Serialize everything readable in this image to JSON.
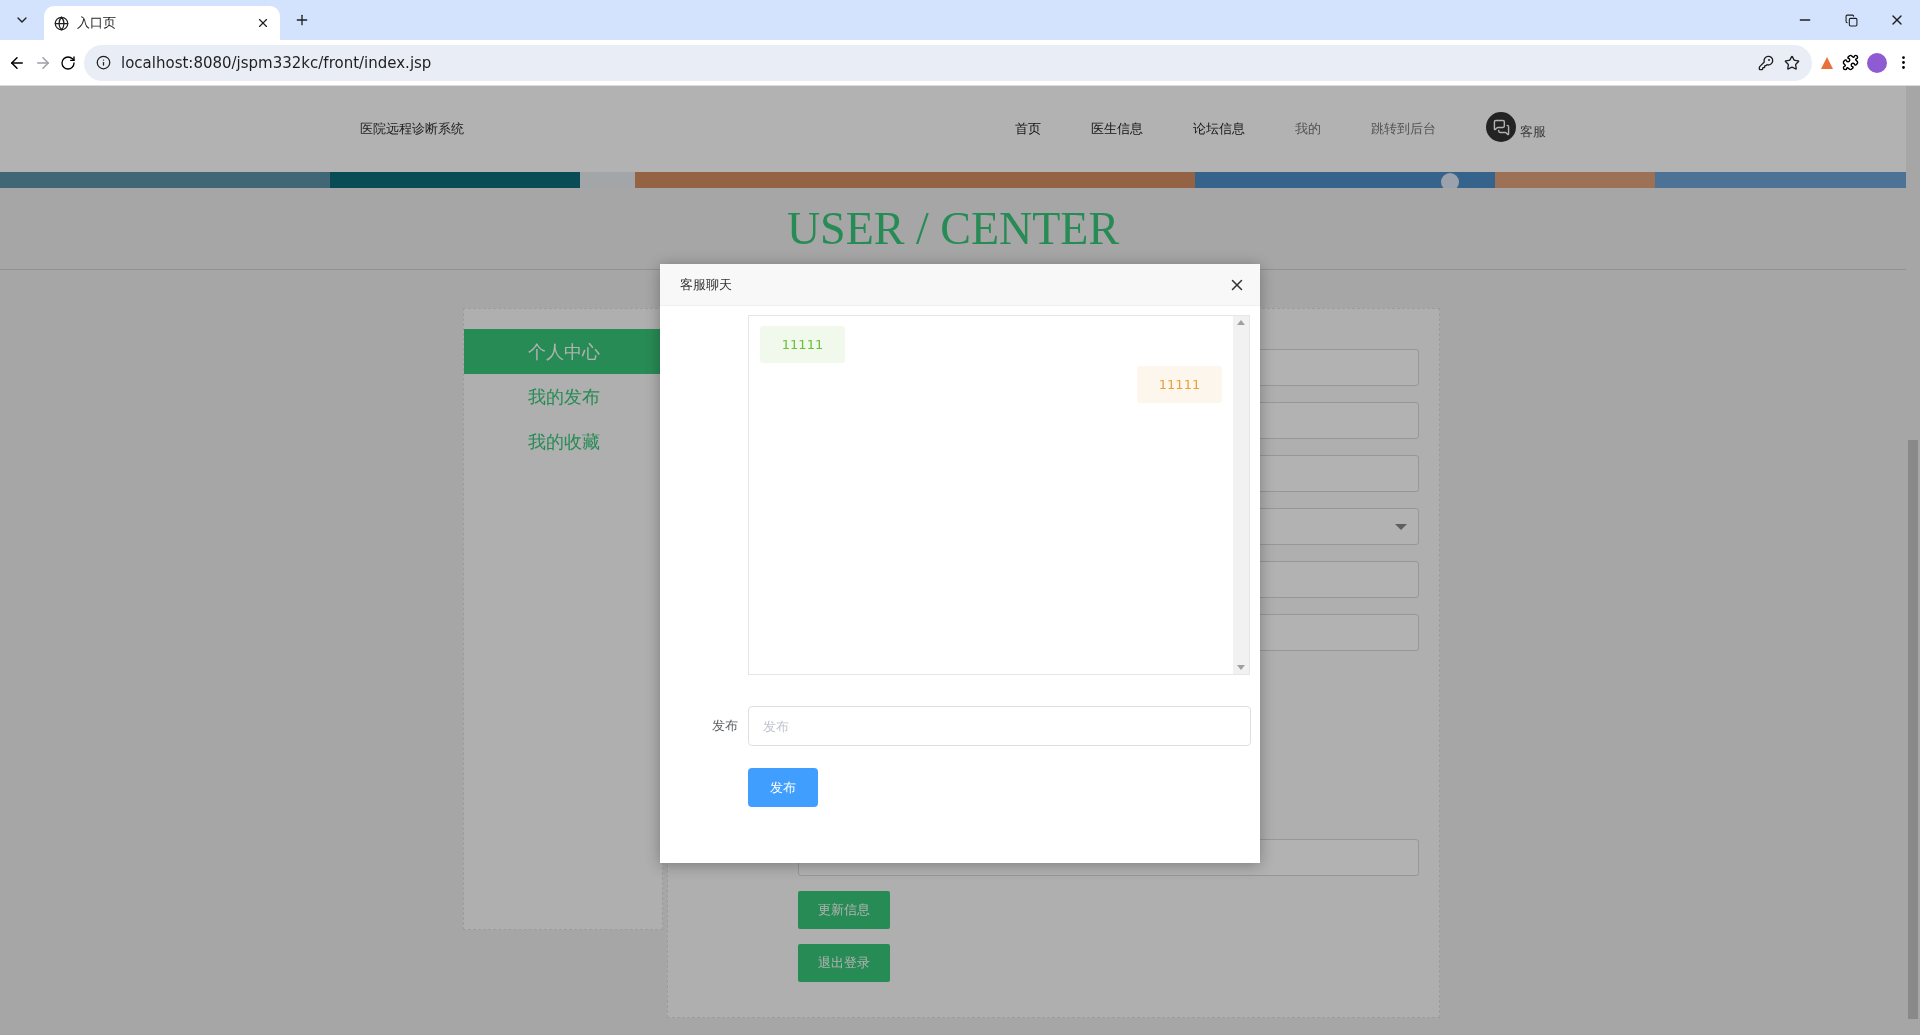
{
  "browser": {
    "tab_title": "入口页",
    "url": "localhost:8080/jspm332kc/front/index.jsp"
  },
  "header": {
    "brand": "医院远程诊断系统",
    "nav": [
      {
        "label": "首页",
        "muted": false
      },
      {
        "label": "医生信息",
        "muted": false
      },
      {
        "label": "论坛信息",
        "muted": false
      },
      {
        "label": "我的",
        "muted": true
      },
      {
        "label": "跳转到后台",
        "muted": true
      }
    ],
    "service": "客服"
  },
  "page_title": "USER / CENTER",
  "sidebar": {
    "items": [
      {
        "label": "个人中心",
        "selected": true
      },
      {
        "label": "我的发布",
        "selected": false
      },
      {
        "label": "我的收藏",
        "selected": false
      }
    ]
  },
  "form": {
    "fields": [
      {
        "kind": "text"
      },
      {
        "kind": "text"
      },
      {
        "kind": "text"
      },
      {
        "kind": "select"
      },
      {
        "kind": "text"
      },
      {
        "kind": "text"
      }
    ],
    "lower_fields": [
      {
        "kind": "text"
      }
    ],
    "buttons": [
      "更新信息",
      "退出登录"
    ]
  },
  "dialog": {
    "title": "客服聊天",
    "messages": [
      {
        "text": "11111",
        "outgoing": false
      },
      {
        "text": "11111",
        "outgoing": true
      }
    ],
    "input_label": "发布",
    "placeholder": "发布",
    "submit": "发布"
  }
}
